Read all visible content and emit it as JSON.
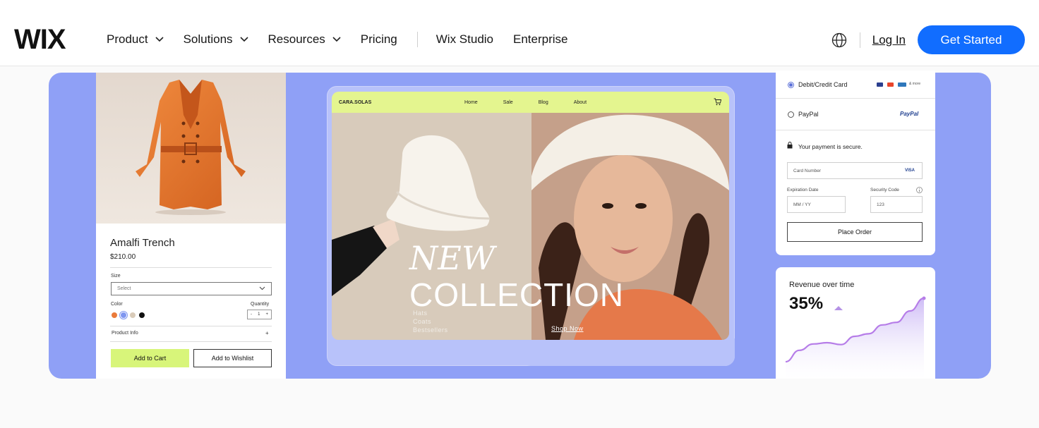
{
  "nav": {
    "logo": "WIX",
    "menu": [
      {
        "label": "Product",
        "has_dropdown": true
      },
      {
        "label": "Solutions",
        "has_dropdown": true
      },
      {
        "label": "Resources",
        "has_dropdown": true
      },
      {
        "label": "Pricing",
        "has_dropdown": false
      }
    ],
    "secondary": [
      "Wix Studio",
      "Enterprise"
    ],
    "globe_icon": "globe-icon",
    "login_label": "Log In",
    "cta_label": "Get Started",
    "cta_color": "#116dff"
  },
  "hero": {
    "background": "#8fa0f6"
  },
  "product_card": {
    "name": "Amalfi Trench",
    "price": "$210.00",
    "size_label": "Size",
    "size_placeholder": "Select",
    "color_label": "Color",
    "quantity_label": "Quantity",
    "quantity_value": "1",
    "quantity_minus": "-",
    "quantity_plus": "+",
    "colors": [
      "#ea7b3b",
      "#7f96f0",
      "#d9cbb9",
      "#111111"
    ],
    "info_label": "Product Info",
    "info_toggle": "+",
    "add_to_cart": "Add to Cart",
    "add_to_wishlist": "Add to Wishlist"
  },
  "store": {
    "brand": "CARA.SOLAS",
    "links": [
      "Home",
      "Sale",
      "Blog",
      "About"
    ],
    "cart_icon": "cart-icon",
    "headline_1": "NEW",
    "headline_2": "COLLECTION",
    "categories": [
      "Hats",
      "Coats",
      "Bestsellers"
    ],
    "shop_now": "Shop Now",
    "nav_color": "#e4f58f"
  },
  "payment": {
    "option_card": "Debit/Credit Card",
    "option_more": "& more",
    "option_paypal": "PayPal",
    "paypal_logo": "PayPal",
    "secure_text": "Your payment is secure.",
    "card_number_placeholder": "Card Number",
    "card_brand": "VISA",
    "expiration_label": "Expiration Date",
    "expiration_placeholder": "MM / YY",
    "security_label": "Security Code",
    "security_placeholder": "123",
    "place_order": "Place Order"
  },
  "revenue": {
    "title": "Revenue over time",
    "value": "35%",
    "trend": "up",
    "chart_data": {
      "type": "area",
      "x": [
        0,
        1,
        2,
        3,
        4,
        5,
        6,
        7,
        8,
        9,
        10
      ],
      "values": [
        0,
        18,
        28,
        30,
        27,
        40,
        44,
        58,
        62,
        80,
        100
      ],
      "line_color": "#b67de8"
    }
  }
}
